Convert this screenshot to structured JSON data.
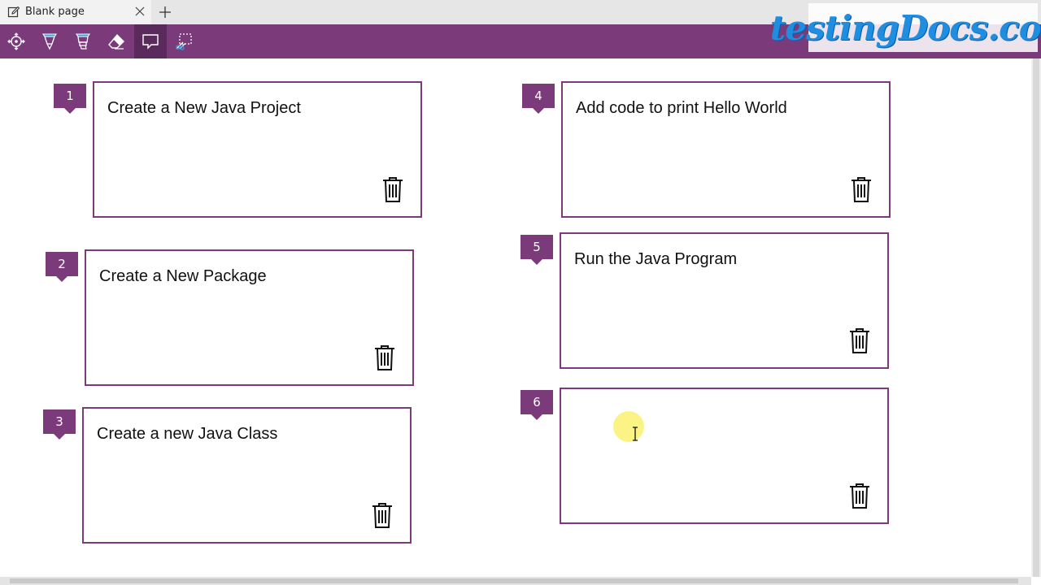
{
  "tab": {
    "title": "Blank page"
  },
  "watermark": {
    "text": "testingDocs.com"
  },
  "toolbar": {
    "tools": [
      {
        "name": "pan-tool",
        "icon": "crosshair-icon",
        "active": false
      },
      {
        "name": "pen-tool",
        "icon": "pen-icon",
        "active": false
      },
      {
        "name": "highlighter-tool",
        "icon": "highlighter-icon",
        "active": false
      },
      {
        "name": "eraser-tool",
        "icon": "eraser-icon",
        "active": false
      },
      {
        "name": "add-note-tool",
        "icon": "comment-icon",
        "active": true
      },
      {
        "name": "clip-tool",
        "icon": "clip-icon",
        "active": false
      }
    ]
  },
  "notes": [
    {
      "number": "1",
      "text": "Create a New Java Project"
    },
    {
      "number": "2",
      "text": "Create a New Package"
    },
    {
      "number": "3",
      "text": "Create a new Java Class"
    },
    {
      "number": "4",
      "text": "Add code to print Hello World"
    },
    {
      "number": "5",
      "text": "Run the Java Program"
    },
    {
      "number": "6",
      "text": ""
    }
  ],
  "colors": {
    "accent": "#7b3b7b",
    "accent_dark": "#5b2a5c"
  }
}
